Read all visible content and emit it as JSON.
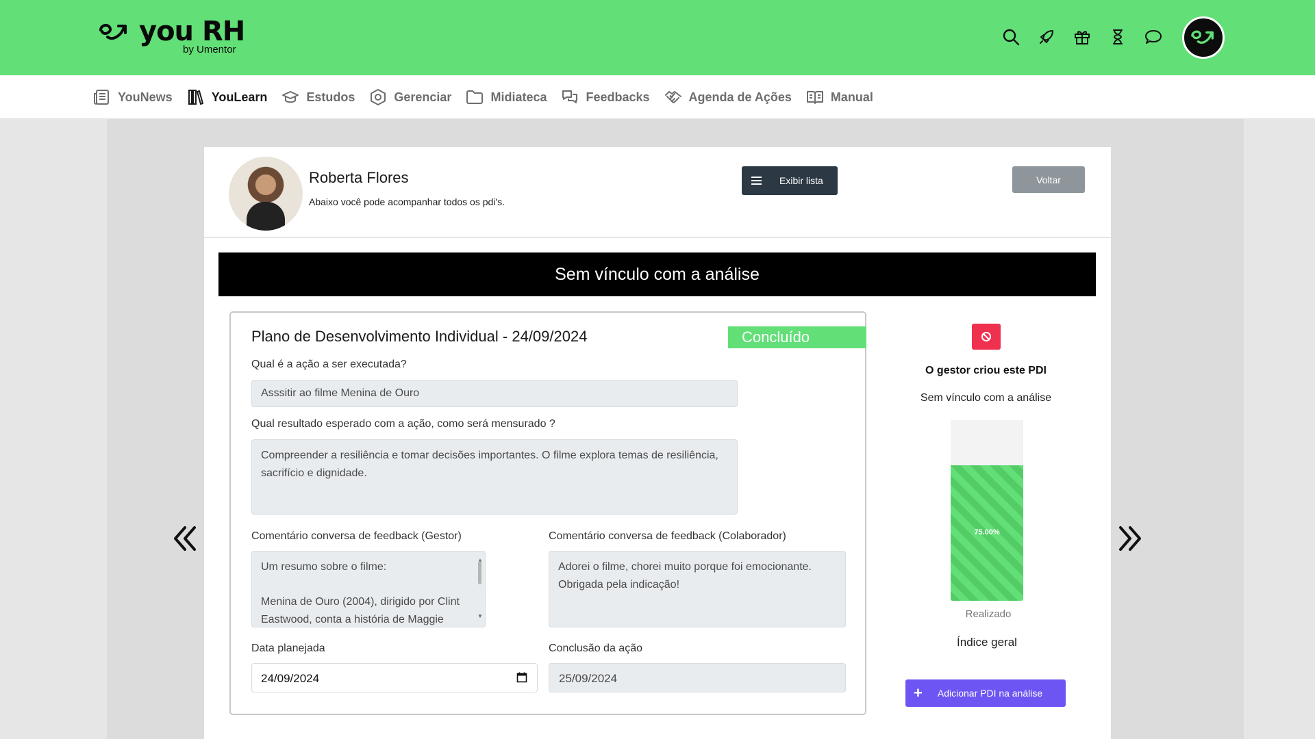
{
  "brand": {
    "logo_text": "you RH",
    "logo_sub": "by Umentor",
    "accent": "#62df77"
  },
  "top_icons": [
    "search-icon",
    "rocket-icon",
    "gift-icon",
    "hourglass-icon",
    "chat-icon"
  ],
  "nav": {
    "items": [
      {
        "label": "YouNews",
        "icon": "newspaper-icon"
      },
      {
        "label": "YouLearn",
        "icon": "books-icon",
        "active": true
      },
      {
        "label": "Estudos",
        "icon": "graduation-cap-icon"
      },
      {
        "label": "Gerenciar",
        "icon": "hexagon-settings-icon"
      },
      {
        "label": "Midiateca",
        "icon": "folder-icon"
      },
      {
        "label": "Feedbacks",
        "icon": "chat-bubbles-icon"
      },
      {
        "label": "Agenda de Ações",
        "icon": "handshake-icon"
      },
      {
        "label": "Manual",
        "icon": "book-open-icon"
      }
    ]
  },
  "profile": {
    "name": "Roberta Flores",
    "subtitle": "Abaixo você pode acompanhar todos os pdi's.",
    "list_button": "Exibir lista",
    "back_button": "Voltar"
  },
  "banner": "Sem vínculo com a análise",
  "pdi": {
    "title": "Plano de Desenvolvimento Individual - 24/09/2024",
    "status": "Concluído",
    "q_action_label": "Qual é a ação a ser executada?",
    "q_action_value": "Asssitir ao filme Menina de Ouro",
    "q_result_label": "Qual resultado esperado com a ação, como será mensurado ?",
    "q_result_value": "Compreender a resiliência e tomar decisões importantes. O filme explora temas de resiliência, sacrifício e dignidade.",
    "gestor_label": "Comentário conversa de feedback (Gestor)",
    "gestor_line1": "Um resumo sobre o filme:",
    "gestor_line2": "Menina de Ouro (2004), dirigido por Clint",
    "gestor_line3": "Eastwood, conta a história de Maggie",
    "colab_label": "Comentário conversa de feedback (Colaborador)",
    "colab_value": "Adorei o filme, chorei muito porque foi emocionante. Obrigada pela indicação!",
    "planned_label": "Data planejada",
    "planned_value": "24/09/2024",
    "conclusion_label": "Conclusão da ação",
    "conclusion_value": "25/09/2024"
  },
  "side": {
    "gestor_text": "O gestor criou este PDI",
    "link_text": "Sem vínculo com a análise",
    "progress": 0.75,
    "progress_label": "75.00%",
    "realizado": "Realizado",
    "indice": "Índice geral",
    "add_button": "Adicionar PDI na análise"
  }
}
